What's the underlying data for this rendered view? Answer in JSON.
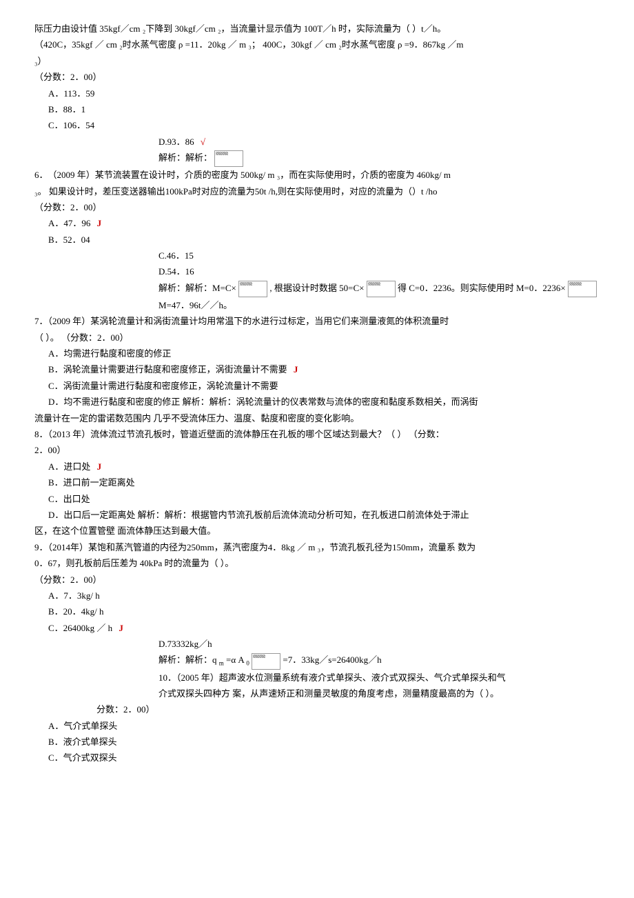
{
  "q5": {
    "cont_l1": "际压力由设计值 35kgf／cm ₂下降到 30kgf／cm ₂，当流量计显示值为 100T／h 时，实际流量为（ ）t／h。",
    "cont_l2": "（420C，35kgf ／ cm ₂时水蒸气密度 ρ =11．20kg ／ m ₃； 400C，30kgf ／ cm ₂时水蒸气密度 ρ =9．867kg ／m",
    "cont_l3": "₃）",
    "score": "（分数：2．00）",
    "optA": "A．113．59",
    "optB": "B．88．1",
    "optC": "C．106．54",
    "optD": "D.93．86",
    "ana": "解析：解析："
  },
  "q6": {
    "stem_l1": "6．　（2009 年）某节流装置在设计时，介质的密度为 500kg/ m ₃，而在实际使用时，介质的密度为 460kg/ m",
    "stem_l2": "₃。 如果设计时，差压变送器输出100kPa时对应的流量为50t /h,则在实际使用时，对应的流量为（）t /ho",
    "score": "（分数：2．00）",
    "optA": "A．47．96",
    "optB": "B．52．04",
    "optC": "C.46．15",
    "optD": "D.54．16",
    "ana_l1a": "解析：解析：M=C×",
    "ana_l1b": ", 根据设计时数据 50=C×",
    "ana_l1c": "得 C=0．2236。则实际使用时 M=0．2236×",
    "ana_l2": "M=47．96t／／h。"
  },
  "q7": {
    "stem_l1": "7．（2009 年）某涡轮流量计和涡街流量计均用常温下的水进行过标定，当用它们来测量液氮的体积流量时",
    "stem_l2": "（ ）。 （分数：2．00）",
    "optA": "A．均需进行黏度和密度的修正",
    "optB": "B．涡轮流量计需要进行黏度和密度修正，涡街流量计不需要",
    "optC": "C．涡街流量计需进行黏度和密度修正，涡轮流量计不需要",
    "optD_l1": "D．均不需进行黏度和密度的修正 解析：解析：涡轮流量计的仪表常数与流体的密度和黏度系数相关，而涡街",
    "optD_l2": "流量计在一定的雷诺数范围内 几乎不受流体压力、温度、黏度和密度的变化影响。"
  },
  "q8": {
    "stem_l1": "8．（2013 年）流体流过节流孔板时，管道近壁面的流体静压在孔板的哪个区域达到最大？（ ） （分数：",
    "stem_l2": "2．00）",
    "optA": "A．进口处",
    "optB": "B．进口前一定距离处",
    "optC": "C．出口处",
    "optD_l1": "D．出口后一定距离处 解析：解析：根据管内节流孔板前后流体流动分析可知，在孔板进口前流体处于滞止",
    "optD_l2": "区，在这个位置管壁 面流体静压达到最大值。"
  },
  "q9": {
    "stem_l1": "9．（2014年）某饱和蒸汽管道的内径为250mm，蒸汽密度为4．8kg ／ m ₃，节流孔板孔径为150mm，流量系 数为",
    "stem_l2": "0．67，则孔板前后压差为 40kPa 时的流量为（ ）。",
    "score": "（分数：2．00）",
    "optA": "A．7．3kg/ h",
    "optB": "B．20．4kg/ h",
    "optC": "C．26400kg ／ h",
    "optD": "D.73332kg／h",
    "ana_a": "解析：解析：q ",
    "ana_sub": "m",
    "ana_b": " =α A ",
    "ana_sub2": "0",
    "ana_c": "=7．33kg／s=26400kg／h"
  },
  "q10": {
    "stem_l1": "10．（2005 年）超声波水位测量系统有液介式单探头、液介式双探头、气介式单探头和气",
    "stem_l2": "介式双探头四种方 案，从声速矫正和测量灵敏度的角度考虑，测量精度最高的为（ ）。",
    "score": "分数：2．00）",
    "optA": "A．气介式单探头",
    "optB": "B．液介式单探头",
    "optC": "C．气介式双探头"
  },
  "checkmark": "√",
  "jmark": "J"
}
